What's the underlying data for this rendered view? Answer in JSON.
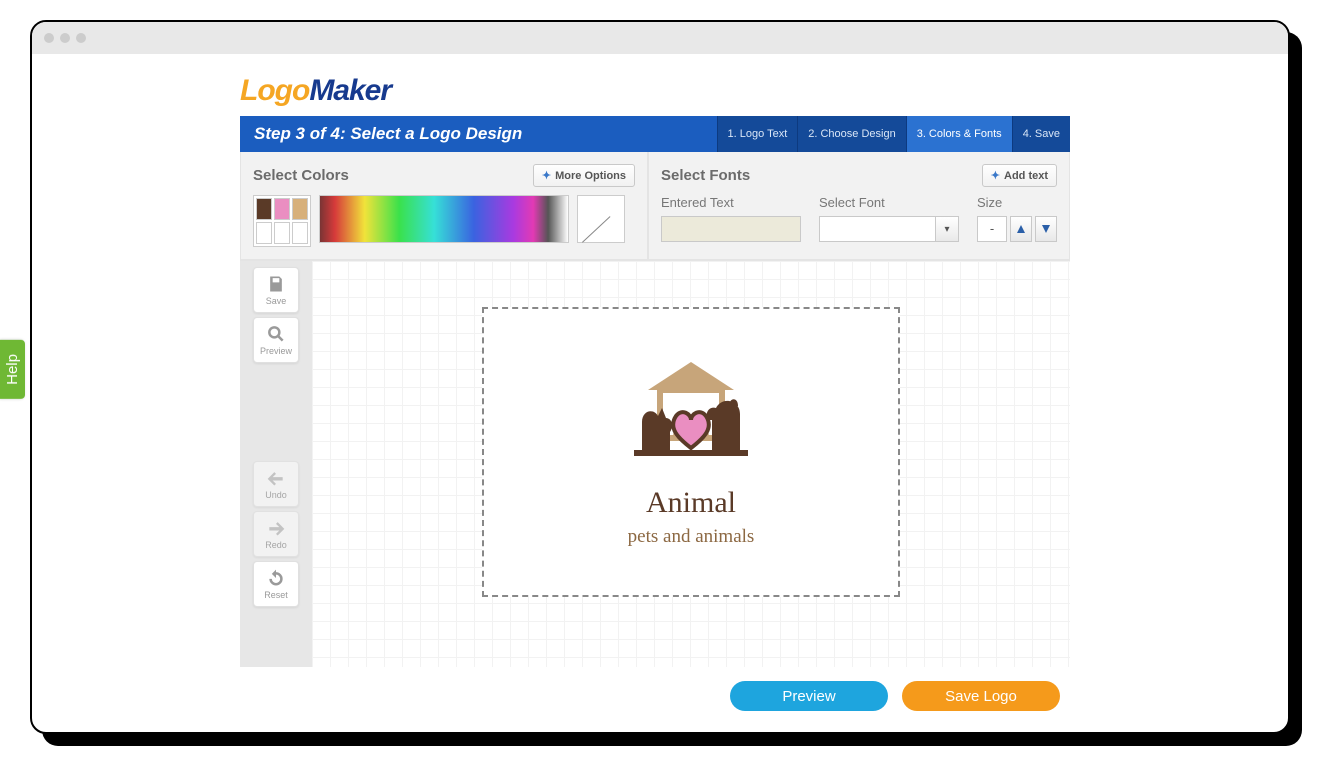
{
  "brand": {
    "part1": "Logo",
    "part2": "Maker"
  },
  "step_title": "Step 3 of 4: Select a Logo Design",
  "steps": [
    "1. Logo Text",
    "2. Choose Design",
    "3. Colors & Fonts",
    "4. Save"
  ],
  "active_step_index": 2,
  "colors_panel": {
    "title": "Select Colors",
    "more": "More Options"
  },
  "swatches": [
    "#5a3a27",
    "#ea8ec1",
    "#d7b07b",
    "#ffffff",
    "#ffffff",
    "#ffffff"
  ],
  "fonts_panel": {
    "title": "Select Fonts",
    "add": "Add text",
    "entered_label": "Entered Text",
    "select_label": "Select Font",
    "size_label": "Size",
    "size_value": "-"
  },
  "tools": {
    "save": "Save",
    "preview": "Preview",
    "undo": "Undo",
    "redo": "Redo",
    "reset": "Reset"
  },
  "logo": {
    "title": "Animal",
    "subtitle": "pets and animals"
  },
  "buttons": {
    "preview": "Preview",
    "save": "Save Logo"
  },
  "help": "Help"
}
